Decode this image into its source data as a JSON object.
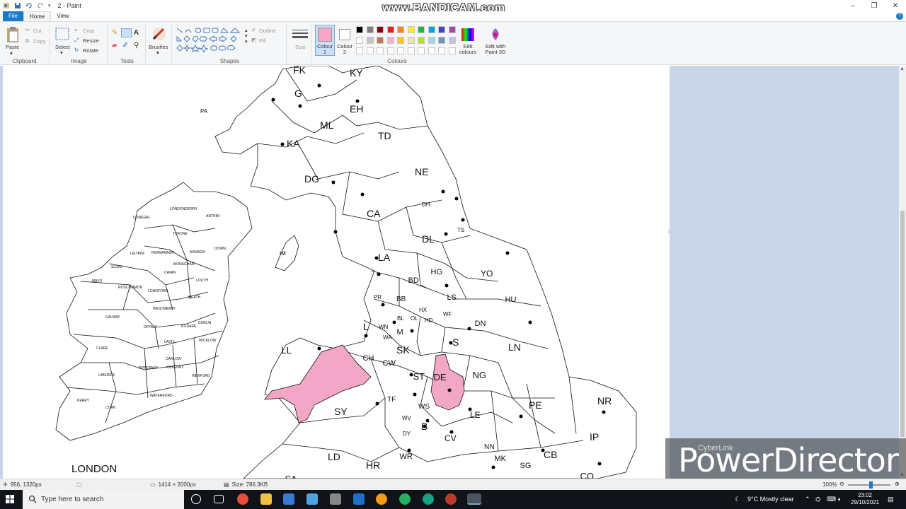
{
  "window": {
    "title": "2 - Paint",
    "watermark": "www.BANDICAM.com",
    "controls": [
      "–",
      "❐",
      "✕"
    ]
  },
  "tabs": [
    {
      "label": "File"
    },
    {
      "label": "Home"
    },
    {
      "label": "View"
    }
  ],
  "ribbon": {
    "clipboard": {
      "label": "Clipboard",
      "paste": "Paste",
      "cut": "Cut",
      "copy": "Copy"
    },
    "image": {
      "label": "Image",
      "select": "Select",
      "crop": "Crop",
      "resize": "Resize",
      "rotate": "Rotate"
    },
    "tools": {
      "label": "Tools"
    },
    "brushes": {
      "label": "Brushes"
    },
    "shapes": {
      "label": "Shapes",
      "outline": "Outline",
      "fill": "Fill"
    },
    "size": {
      "label": "Size"
    },
    "colours": {
      "label": "Colours",
      "colour1": "Colour 1",
      "colour1_line1": "Colour",
      "colour1_line2": "1",
      "colour2_line1": "Colour",
      "colour2_line2": "2",
      "colour1_value": "#f4a6c4",
      "colour2_value": "#ffffff",
      "edit_line1": "Edit",
      "edit_line2": "colours",
      "paint3d_line1": "Edit with",
      "paint3d_line2": "Paint 3D",
      "palette_row1": [
        "#000000",
        "#7f7f7f",
        "#880015",
        "#ed1c24",
        "#ff7f27",
        "#fff200",
        "#22b14c",
        "#00a2e8",
        "#3f48cc",
        "#a349a4"
      ],
      "palette_row2": [
        "#ffffff",
        "#c3c3c3",
        "#b97a57",
        "#ffaec9",
        "#ffc90e",
        "#efe4b0",
        "#b5e61d",
        "#99d9ea",
        "#7092be",
        "#c8bfe7"
      ]
    }
  },
  "map": {
    "highlight_color": "#f2a7c6",
    "irish_counties": [
      "DONEGAL",
      "LONDONDERRY",
      "ANTRIM",
      "TYRONE",
      "DOWN",
      "ARMAGH",
      "FERMANAGH",
      "LEITRIM",
      "SLIGO",
      "MONAGHAN",
      "CAVAN",
      "MAYO",
      "ROSCOMMON",
      "LONGFORD",
      "LOUTH",
      "MEATH",
      "WESTMEATH",
      "GALWAY",
      "OFFALY",
      "KILDARE",
      "DUBLIN",
      "LAOIS",
      "WICKLOW",
      "CLARE",
      "CARLOW",
      "TIPPERARY",
      "KILKENNY",
      "LIMERICK",
      "WEXFORD",
      "KERRY",
      "CORK",
      "WATERFORD"
    ],
    "postcode_areas": [
      "FK",
      "KY",
      "G",
      "PA",
      "EH",
      "ML",
      "KA",
      "TD",
      "DG",
      "NE",
      "CA",
      "DH",
      "IM",
      "TS",
      "DL",
      "LA",
      "HG",
      "YO",
      "BD",
      "PR",
      "BB",
      "LS",
      "HU",
      "HX",
      "WF",
      "BL",
      "OL",
      "HD",
      "DN",
      "WN",
      "L",
      "M",
      "S",
      "WA",
      "LN",
      "LL",
      "SK",
      "CH",
      "CW",
      "ST",
      "DE",
      "NG",
      "SY",
      "TF",
      "WS",
      "LE",
      "PE",
      "NR",
      "WV",
      "B",
      "DY",
      "CV",
      "IP",
      "NN",
      "LD",
      "WR",
      "MK",
      "CB",
      "SG",
      "HR",
      "CO",
      "SA"
    ],
    "london_label": "LONDON"
  },
  "status": {
    "cursor_pos": "956, 1320px",
    "image_size": "1414 × 2000px",
    "file_size": "Size: 786.3KB",
    "zoom": "100%"
  },
  "overlay": {
    "brand_small": "CyberLink",
    "brand_big": "PowerDirector"
  },
  "taskbar": {
    "search_placeholder": "Type here to search",
    "weather": "9°C  Mostly clear",
    "time": "23:02",
    "date": "29/10/2021"
  }
}
